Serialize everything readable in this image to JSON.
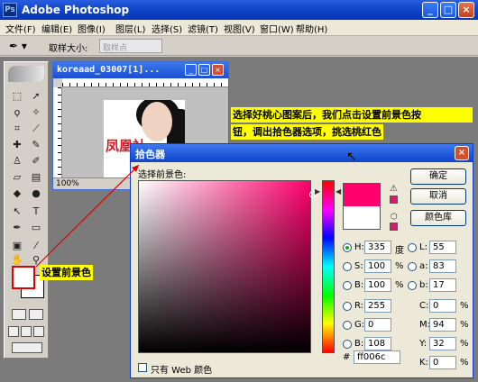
{
  "app": {
    "title": "Adobe Photoshop",
    "logo": "Ps"
  },
  "window_controls": {
    "minimize": "_",
    "maximize": "□",
    "close": "×"
  },
  "menu": [
    "文件(F)",
    "编辑(E)",
    "图像(I)",
    "图层(L)",
    "选择(S)",
    "滤镜(T)",
    "视图(V)",
    "窗口(W)",
    "帮助(H)"
  ],
  "options": {
    "tool_icon": "eyedropper-icon",
    "sample_label": "取样大小:",
    "sample_value": "取样点"
  },
  "document": {
    "title": "koreaad_03007[1]...",
    "zoom": "100%",
    "photo_text": "凤凰社"
  },
  "annotations": {
    "top_note_line1": "选择好桃心图案后，我们点击设置前景色按",
    "top_note_line2": "钮，调出拾色器选项，挑选桃红色",
    "fg_note": "设置前景色"
  },
  "picker": {
    "title": "拾色器",
    "prompt": "选择前景色:",
    "buttons": {
      "ok": "确定",
      "cancel": "取消",
      "library": "颜色库"
    },
    "new_color": "#ff006c",
    "old_color": "#ffffff",
    "fields": {
      "H": {
        "label": "H:",
        "value": "335",
        "unit": "度"
      },
      "S": {
        "label": "S:",
        "value": "100",
        "unit": "%"
      },
      "B": {
        "label": "B:",
        "value": "100",
        "unit": "%"
      },
      "R": {
        "label": "R:",
        "value": "255"
      },
      "G": {
        "label": "G:",
        "value": "0"
      },
      "Bl": {
        "label": "B:",
        "value": "108"
      },
      "L": {
        "label": "L:",
        "value": "55"
      },
      "a": {
        "label": "a:",
        "value": "83"
      },
      "b": {
        "label": "b:",
        "value": "17"
      },
      "C": {
        "label": "C:",
        "value": "0",
        "unit": "%"
      },
      "M": {
        "label": "M:",
        "value": "94",
        "unit": "%"
      },
      "Y": {
        "label": "Y:",
        "value": "32",
        "unit": "%"
      },
      "K": {
        "label": "K:",
        "value": "0",
        "unit": "%"
      }
    },
    "hex_prefix": "#",
    "hex": "ff006c",
    "web_only": "只有 Web 颜色"
  }
}
